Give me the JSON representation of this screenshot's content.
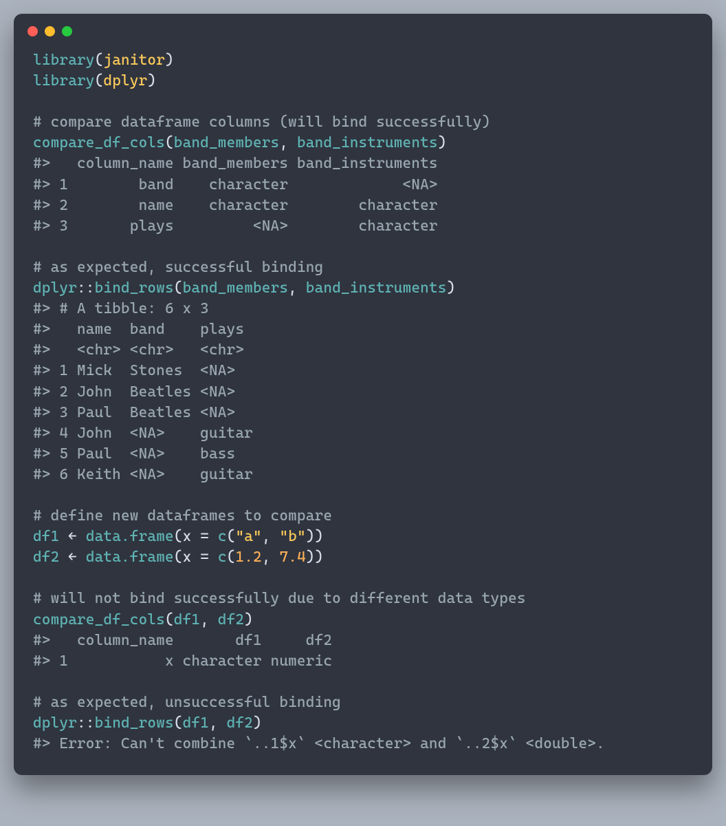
{
  "colors": {
    "bg": "#2f343f",
    "teal": "#5fb3b3",
    "yellow": "#f9c859",
    "orange": "#f9ae58",
    "muted": "#9aa7b0",
    "text": "#d8dee9"
  },
  "dots": [
    "red",
    "yellow",
    "green"
  ],
  "lines": [
    [
      {
        "t": "library",
        "c": "fn"
      },
      {
        "t": "(",
        "c": "pun"
      },
      {
        "t": "janitor",
        "c": "str"
      },
      {
        "t": ")",
        "c": "pun"
      }
    ],
    [
      {
        "t": "library",
        "c": "fn"
      },
      {
        "t": "(",
        "c": "pun"
      },
      {
        "t": "dplyr",
        "c": "str"
      },
      {
        "t": ")",
        "c": "pun"
      }
    ],
    [
      {
        "t": "",
        "c": "pun"
      }
    ],
    [
      {
        "t": "# compare dataframe columns (will bind successfully)",
        "c": "cmt"
      }
    ],
    [
      {
        "t": "compare_df_cols",
        "c": "fn"
      },
      {
        "t": "(",
        "c": "pun"
      },
      {
        "t": "band_members",
        "c": "ident"
      },
      {
        "t": ", ",
        "c": "pun"
      },
      {
        "t": "band_instruments",
        "c": "ident"
      },
      {
        "t": ")",
        "c": "pun"
      }
    ],
    [
      {
        "t": "#>   column_name band_members band_instruments",
        "c": "out"
      }
    ],
    [
      {
        "t": "#> 1        band    character             <NA>",
        "c": "out"
      }
    ],
    [
      {
        "t": "#> 2        name    character        character",
        "c": "out"
      }
    ],
    [
      {
        "t": "#> 3       plays         <NA>        character",
        "c": "out"
      }
    ],
    [
      {
        "t": "",
        "c": "pun"
      }
    ],
    [
      {
        "t": "# as expected, successful binding",
        "c": "cmt"
      }
    ],
    [
      {
        "t": "dplyr",
        "c": "fn"
      },
      {
        "t": "::",
        "c": "pun"
      },
      {
        "t": "bind_rows",
        "c": "fn"
      },
      {
        "t": "(",
        "c": "pun"
      },
      {
        "t": "band_members",
        "c": "ident"
      },
      {
        "t": ", ",
        "c": "pun"
      },
      {
        "t": "band_instruments",
        "c": "ident"
      },
      {
        "t": ")",
        "c": "pun"
      }
    ],
    [
      {
        "t": "#> # A tibble: 6 x 3",
        "c": "out"
      }
    ],
    [
      {
        "t": "#>   name  band    plays ",
        "c": "out"
      }
    ],
    [
      {
        "t": "#>   <chr> <chr>   <chr> ",
        "c": "out"
      }
    ],
    [
      {
        "t": "#> 1 Mick  Stones  <NA>  ",
        "c": "out"
      }
    ],
    [
      {
        "t": "#> 2 John  Beatles <NA>  ",
        "c": "out"
      }
    ],
    [
      {
        "t": "#> 3 Paul  Beatles <NA>  ",
        "c": "out"
      }
    ],
    [
      {
        "t": "#> 4 John  <NA>    guitar",
        "c": "out"
      }
    ],
    [
      {
        "t": "#> 5 Paul  <NA>    bass  ",
        "c": "out"
      }
    ],
    [
      {
        "t": "#> 6 Keith <NA>    guitar",
        "c": "out"
      }
    ],
    [
      {
        "t": "",
        "c": "pun"
      }
    ],
    [
      {
        "t": "# define new dataframes to compare",
        "c": "cmt"
      }
    ],
    [
      {
        "t": "df1",
        "c": "ident"
      },
      {
        "t": " ← ",
        "c": "arrow"
      },
      {
        "t": "data.frame",
        "c": "fn"
      },
      {
        "t": "(",
        "c": "pun"
      },
      {
        "t": "x ",
        "c": "pkg"
      },
      {
        "t": "= ",
        "c": "pun"
      },
      {
        "t": "c",
        "c": "fn"
      },
      {
        "t": "(",
        "c": "pun"
      },
      {
        "t": "\"a\"",
        "c": "str"
      },
      {
        "t": ", ",
        "c": "pun"
      },
      {
        "t": "\"b\"",
        "c": "str"
      },
      {
        "t": "))",
        "c": "pun"
      }
    ],
    [
      {
        "t": "df2",
        "c": "ident"
      },
      {
        "t": " ← ",
        "c": "arrow"
      },
      {
        "t": "data.frame",
        "c": "fn"
      },
      {
        "t": "(",
        "c": "pun"
      },
      {
        "t": "x ",
        "c": "pkg"
      },
      {
        "t": "= ",
        "c": "pun"
      },
      {
        "t": "c",
        "c": "fn"
      },
      {
        "t": "(",
        "c": "pun"
      },
      {
        "t": "1.2",
        "c": "num"
      },
      {
        "t": ", ",
        "c": "pun"
      },
      {
        "t": "7.4",
        "c": "num"
      },
      {
        "t": "))",
        "c": "pun"
      }
    ],
    [
      {
        "t": "",
        "c": "pun"
      }
    ],
    [
      {
        "t": "# will not bind successfully due to different data types",
        "c": "cmt"
      }
    ],
    [
      {
        "t": "compare_df_cols",
        "c": "fn"
      },
      {
        "t": "(",
        "c": "pun"
      },
      {
        "t": "df1",
        "c": "ident"
      },
      {
        "t": ", ",
        "c": "pun"
      },
      {
        "t": "df2",
        "c": "ident"
      },
      {
        "t": ")",
        "c": "pun"
      }
    ],
    [
      {
        "t": "#>   column_name       df1     df2",
        "c": "out"
      }
    ],
    [
      {
        "t": "#> 1           x character numeric",
        "c": "out"
      }
    ],
    [
      {
        "t": "",
        "c": "pun"
      }
    ],
    [
      {
        "t": "# as expected, unsuccessful binding",
        "c": "cmt"
      }
    ],
    [
      {
        "t": "dplyr",
        "c": "fn"
      },
      {
        "t": "::",
        "c": "pun"
      },
      {
        "t": "bind_rows",
        "c": "fn"
      },
      {
        "t": "(",
        "c": "pun"
      },
      {
        "t": "df1",
        "c": "ident"
      },
      {
        "t": ", ",
        "c": "pun"
      },
      {
        "t": "df2",
        "c": "ident"
      },
      {
        "t": ")",
        "c": "pun"
      }
    ],
    [
      {
        "t": "#> Error: Can't combine `..1$x` <character> and `..2$x` <double>.",
        "c": "out"
      }
    ]
  ]
}
